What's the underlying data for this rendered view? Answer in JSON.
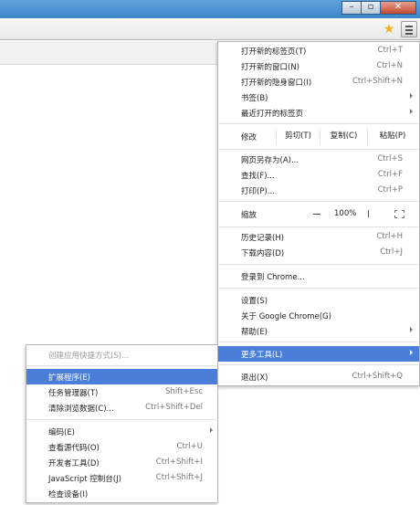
{
  "window": {
    "minimize_glyph": "–",
    "maximize_glyph": "▫",
    "close_glyph": "✕",
    "title_color": "#3f86c8"
  },
  "toolbar": {
    "bookmark_icon": "star-icon",
    "menu_icon": "hamburger-menu-icon"
  },
  "main_menu": {
    "new_tab": {
      "label": "打开新的标签页(T)",
      "shortcut": "Ctrl+T"
    },
    "new_window": {
      "label": "打开新的窗口(N)",
      "shortcut": "Ctrl+N"
    },
    "new_incognito": {
      "label": "打开新的隐身窗口(I)",
      "shortcut": "Ctrl+Shift+N"
    },
    "bookmarks": {
      "label": "书签(B)"
    },
    "recent_tabs": {
      "label": "最近打开的标签页"
    },
    "edit": {
      "label": "修改",
      "cut": "剪切(T)",
      "copy": "复制(C)",
      "paste": "粘贴(P)"
    },
    "save_page": {
      "label": "网页另存为(A)...",
      "shortcut": "Ctrl+S"
    },
    "find": {
      "label": "查找(F)...",
      "shortcut": "Ctrl+F"
    },
    "print": {
      "label": "打印(P)...",
      "shortcut": "Ctrl+P"
    },
    "zoom": {
      "label": "缩放",
      "value": "100%"
    },
    "history": {
      "label": "历史记录(H)",
      "shortcut": "Ctrl+H"
    },
    "downloads": {
      "label": "下载内容(D)",
      "shortcut": "Ctrl+J"
    },
    "sign_in": {
      "label": "登录到 Chrome..."
    },
    "settings": {
      "label": "设置(S)"
    },
    "about": {
      "label": "关于 Google Chrome(G)"
    },
    "help": {
      "label": "帮助(E)"
    },
    "more_tools": {
      "label": "更多工具(L)"
    },
    "exit": {
      "label": "退出(X)",
      "shortcut": "Ctrl+Shift+Q"
    },
    "highlight_color": "#4a7ed9"
  },
  "sub_menu": {
    "create_shortcuts": {
      "label": "创建应用快捷方式(S)..."
    },
    "extensions": {
      "label": "扩展程序(E)"
    },
    "task_manager": {
      "label": "任务管理器(T)",
      "shortcut": "Shift+Esc"
    },
    "clear_data": {
      "label": "清除浏览数据(C)...",
      "shortcut": "Ctrl+Shift+Del"
    },
    "encoding": {
      "label": "编码(E)"
    },
    "view_source": {
      "label": "查看源代码(O)",
      "shortcut": "Ctrl+U"
    },
    "dev_tools": {
      "label": "开发者工具(D)",
      "shortcut": "Ctrl+Shift+I"
    },
    "js_console": {
      "label": "JavaScript 控制台(J)",
      "shortcut": "Ctrl+Shift+J"
    },
    "inspect_devices": {
      "label": "检查设备(I)"
    }
  }
}
